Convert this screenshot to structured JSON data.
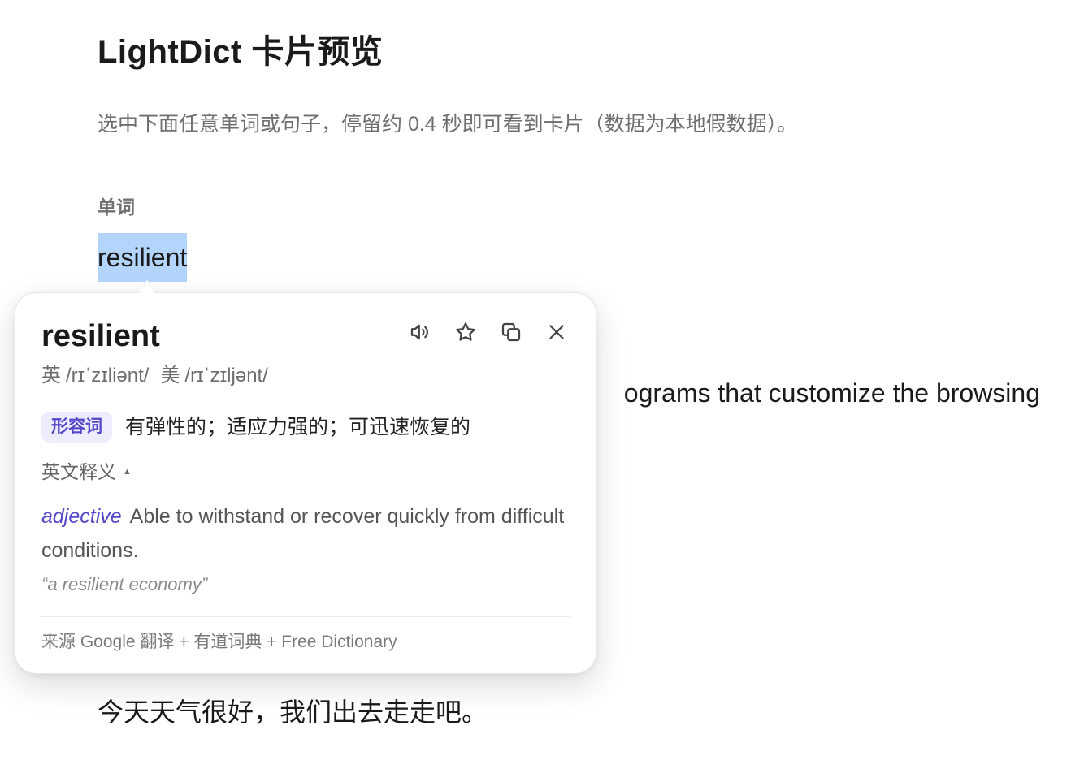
{
  "page": {
    "title": "LightDict 卡片预览",
    "description": "选中下面任意单词或句子，停留约 0.4 秒即可看到卡片（数据为本地假数据）。",
    "word_section_label": "单词",
    "word_sample": "resilient",
    "paragraph_visible_fragment": "ograms that customize the browsing",
    "sentence_sample": "今天天气很好，我们出去走走吧。"
  },
  "card": {
    "word": "resilient",
    "actions": [
      {
        "name": "speak",
        "icon": "speaker-icon"
      },
      {
        "name": "favorite",
        "icon": "star-icon"
      },
      {
        "name": "copy",
        "icon": "copy-icon"
      },
      {
        "name": "close",
        "icon": "close-icon"
      }
    ],
    "phonetics": {
      "uk_label": "英",
      "uk": "/rɪˈzɪliənt/",
      "us_label": "美",
      "us": "/rɪˈzɪljənt/"
    },
    "cn_pos": "形容词",
    "cn_definition": "有弹性的；适应力强的；可迅速恢复的",
    "en_toggle_label": "英文释义",
    "en_toggle_caret": "▲",
    "en_pos": "adjective",
    "en_definition": "Able to withstand or recover quickly from difficult conditions.",
    "example": "“a resilient economy”",
    "source": "来源 Google 翻译 + 有道词典 + Free Dictionary"
  },
  "colors": {
    "selection": "#b4d5fb",
    "accent": "#5448c8",
    "badge_bg": "#eeedfd"
  }
}
